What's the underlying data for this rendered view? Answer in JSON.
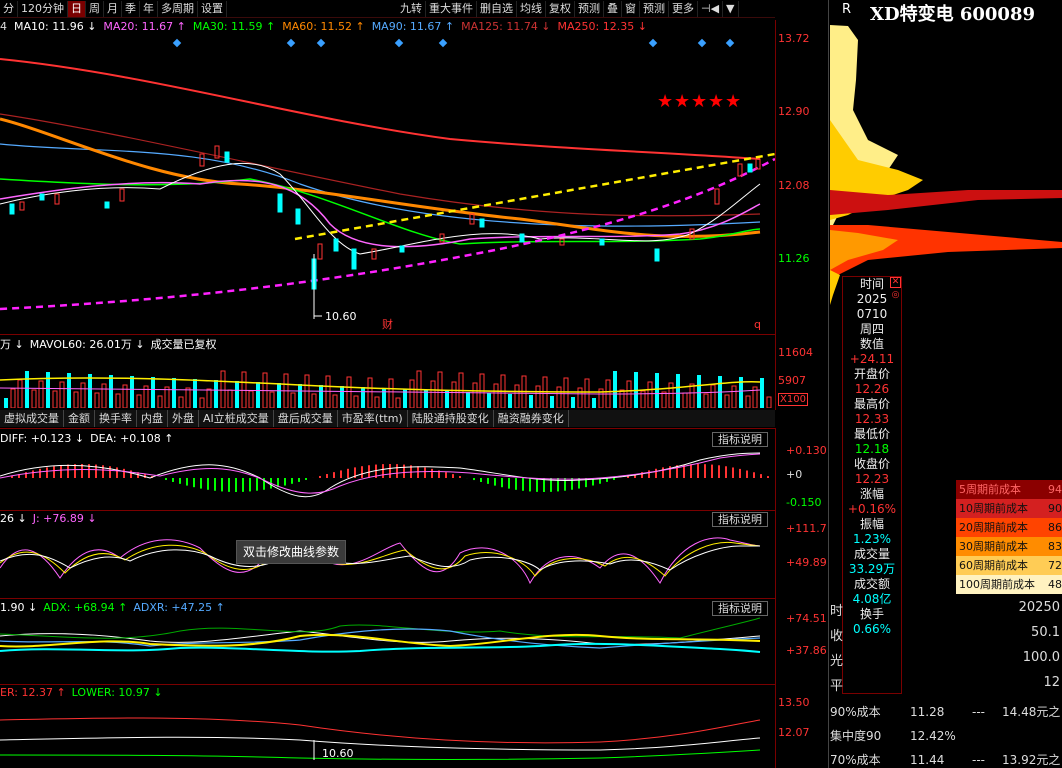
{
  "toolbar": {
    "left_items": [
      "分",
      "120分钟",
      "日",
      "周",
      "月",
      "季",
      "年",
      "多周期",
      "设置"
    ],
    "active": "日",
    "right_items": [
      "九转",
      "重大事件",
      "删自选",
      "均线",
      "复权",
      "预测",
      "叠",
      "窗",
      "预测",
      "更多",
      "⊣◀",
      "▼"
    ]
  },
  "ma_legend": [
    {
      "label": "4",
      "color": "#dddddd"
    },
    {
      "label": "MA10: 11.96 ↓",
      "color": "#ffffff"
    },
    {
      "label": "MA20: 11.67 ↑",
      "color": "#ff66ff"
    },
    {
      "label": "MA30: 11.59 ↑",
      "color": "#00ff00"
    },
    {
      "label": "MA60: 11.52 ↑",
      "color": "#ff8800"
    },
    {
      "label": "MA90: 11.67 ↑",
      "color": "#55aaff"
    },
    {
      "label": "MA125: 11.74 ↓",
      "color": "#cc3333"
    },
    {
      "label": "MA250: 12.35 ↓",
      "color": "#ff3333"
    }
  ],
  "price_axis": [
    "13.72",
    "12.90",
    "12.08",
    "11.26"
  ],
  "price_low_label": "10.60",
  "markers": {
    "cai": "财",
    "q": "q"
  },
  "volume": {
    "legend": [
      {
        "label": "万 ↓",
        "color": "#ffffff"
      },
      {
        "label": "MAVOL60: 26.01万 ↓",
        "color": "#ffffff"
      },
      {
        "label": "成交量已复权",
        "color": "#ffffff"
      }
    ],
    "axis": [
      "11604",
      "5907",
      "X100"
    ]
  },
  "tabs": [
    "虚拟成交量",
    "金额",
    "换手率",
    "内盘",
    "外盘",
    "AI立桩成交量",
    "盘后成交量",
    "市盈率(ttm)",
    "陆股通持股变化",
    "融资融券变化"
  ],
  "macd": {
    "legend": [
      {
        "label": "DIFF: +0.123 ↓",
        "color": "#ffffff"
      },
      {
        "label": "DEA: +0.108 ↑",
        "color": "#ffffff"
      }
    ],
    "axis": [
      "+0.130",
      "+0",
      "-0.150"
    ]
  },
  "kdj": {
    "legend": [
      {
        "label": "26 ↓",
        "color": "#ffffff"
      },
      {
        "label": "J: +76.89 ↓",
        "color": "#ff66ff"
      }
    ],
    "axis": [
      "+111.7",
      "+49.89"
    ]
  },
  "dmi": {
    "legend": [
      {
        "label": "1.90 ↓",
        "color": "#ffffff"
      },
      {
        "label": "ADX: +68.94 ↑",
        "color": "#00ff00"
      },
      {
        "label": "ADXR: +47.25 ↑",
        "color": "#55aaff"
      }
    ],
    "axis": [
      "+74.51",
      "+37.86"
    ]
  },
  "boll": {
    "legend": [
      {
        "label": "ER: 12.37 ↑",
        "color": "#ff3333"
      },
      {
        "label": "LOWER: 10.97 ↓",
        "color": "#00ff00"
      }
    ],
    "axis": [
      "13.50",
      "12.07"
    ],
    "low_label": "10.60"
  },
  "indicator_button": "指标说明",
  "tooltip": "双击修改曲线参数",
  "stock": {
    "title": "XD特变电 600089",
    "r": "R"
  },
  "popup": {
    "items": [
      {
        "k": "时间",
        "v": [
          "2025",
          "0710"
        ],
        "vc": "#eeeeee"
      },
      {
        "k": "周四",
        "v": [],
        "vc": "#eeeeee"
      },
      {
        "k": "数值",
        "v": [
          "+24.11"
        ],
        "vc": "#ff3333"
      },
      {
        "k": "开盘价",
        "v": [
          "12.26"
        ],
        "vc": "#ff3333"
      },
      {
        "k": "最高价",
        "v": [
          "12.33"
        ],
        "vc": "#ff3333"
      },
      {
        "k": "最低价",
        "v": [
          "12.18"
        ],
        "vc": "#00ff00"
      },
      {
        "k": "收盘价",
        "v": [
          "12.23"
        ],
        "vc": "#ff3333"
      },
      {
        "k": "涨幅",
        "v": [
          "+0.16%"
        ],
        "vc": "#ff3333"
      },
      {
        "k": "振幅",
        "v": [
          "1.23%"
        ],
        "vc": "#00ffff"
      },
      {
        "k": "成交量",
        "v": [
          "33.29万"
        ],
        "vc": "#00ffff"
      },
      {
        "k": "成交额",
        "v": [
          "4.08亿"
        ],
        "vc": "#00ffff"
      },
      {
        "k": "换手",
        "v": [
          "0.66%"
        ],
        "vc": "#00ffff"
      }
    ]
  },
  "cost_list": [
    {
      "label": "5周期前成本",
      "val": "94",
      "bg": "#8b0000",
      "fg": "#ff6666"
    },
    {
      "label": "10周期前成本",
      "val": "90",
      "bg": "#d42020",
      "fg": "#111111"
    },
    {
      "label": "20周期前成本",
      "val": "86",
      "bg": "#ff4400",
      "fg": "#111111"
    },
    {
      "label": "30周期前成本",
      "val": "83",
      "bg": "#ff8c00",
      "fg": "#111111"
    },
    {
      "label": "60周期前成本",
      "val": "72",
      "bg": "#ffcc55",
      "fg": "#111111"
    },
    {
      "label": "100周期前成本",
      "val": "48",
      "bg": "#fff2c0",
      "fg": "#111111"
    }
  ],
  "side_fragments": [
    {
      "l": "时",
      "r": "20250"
    },
    {
      "l": "收",
      "r": "50.1"
    },
    {
      "l": "光",
      "r": "100.0"
    },
    {
      "l": "平",
      "r": "12"
    }
  ],
  "bottom_table": [
    {
      "a": "90%成本",
      "b": "11.28",
      "c": "---",
      "d": "14.48元之"
    },
    {
      "a": "集中度90",
      "b": "12.42%",
      "c": "",
      "d": ""
    },
    {
      "a": "70%成本",
      "b": "11.44",
      "c": "---",
      "d": "13.92元之"
    }
  ]
}
